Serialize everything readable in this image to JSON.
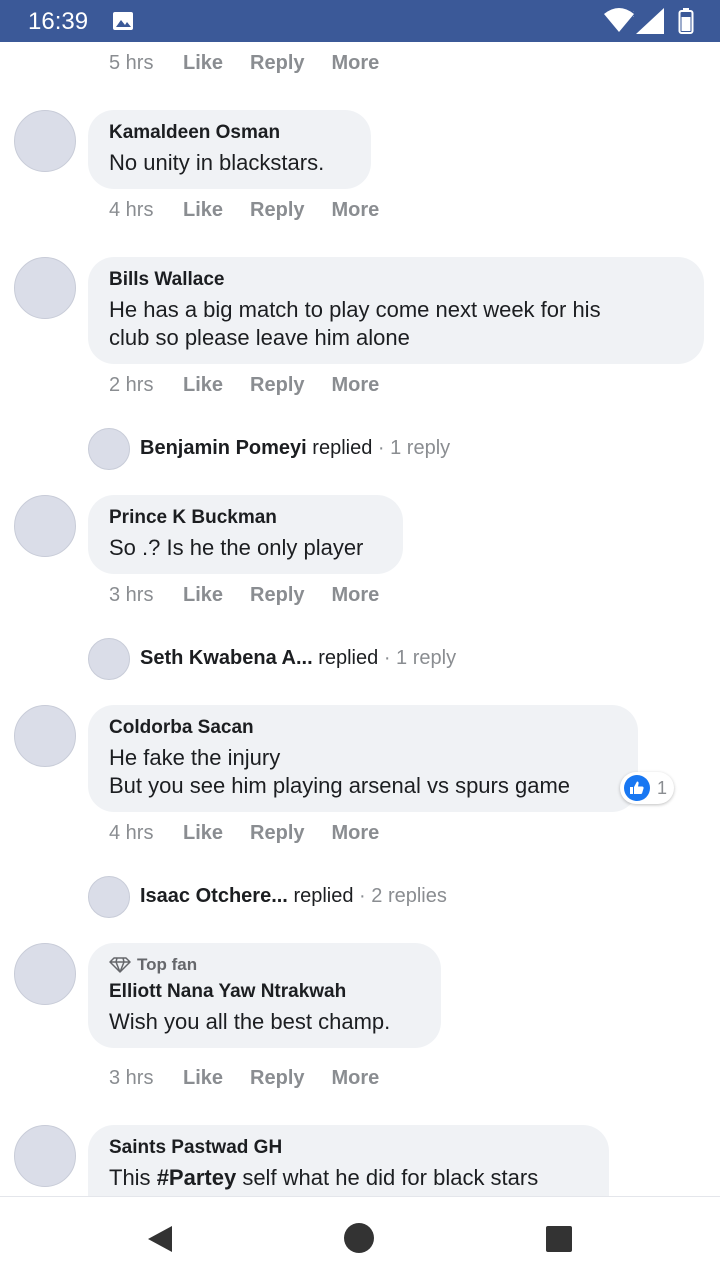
{
  "status_bar": {
    "time": "16:39",
    "icons": [
      "image-icon",
      "wifi-icon",
      "signal-icon",
      "battery-icon"
    ]
  },
  "top_actions": {
    "time": "5 hrs",
    "like": "Like",
    "reply": "Reply",
    "more": "More"
  },
  "comments": [
    {
      "name": "Kamaldeen Osman",
      "text": "No unity in blackstars.",
      "time": "4 hrs",
      "like": "Like",
      "reply": "Reply",
      "more": "More"
    },
    {
      "name": "Bills Wallace",
      "text_lines": [
        "He has a big match to play come next week for his",
        "club so please leave him alone"
      ],
      "time": "2 hrs",
      "like": "Like",
      "reply": "Reply",
      "more": "More",
      "replies": {
        "name": "Benjamin Pomeyi",
        "replied": "replied",
        "separator": "·",
        "count": "1 reply"
      }
    },
    {
      "name": "Prince K Buckman",
      "text": "So .? Is he the only player",
      "time": "3 hrs",
      "like": "Like",
      "reply": "Reply",
      "more": "More",
      "replies": {
        "name": "Seth Kwabena A...",
        "replied": "replied",
        "separator": "·",
        "count": "1 reply"
      }
    },
    {
      "name": "Coldorba Sacan",
      "text_lines": [
        "He fake the injury",
        "But you see him playing arsenal vs spurs game"
      ],
      "time": "4 hrs",
      "like": "Like",
      "reply": "Reply",
      "more": "More",
      "reaction": {
        "icon": "thumbs-up-icon",
        "count": "1"
      },
      "replies": {
        "name": "Isaac Otchere...",
        "replied": "replied",
        "separator": "·",
        "count": "2 replies"
      }
    },
    {
      "badge": "Top fan",
      "name": "Elliott Nana Yaw Ntrakwah",
      "text": "Wish you all the best champ.",
      "time": "3 hrs",
      "like": "Like",
      "reply": "Reply",
      "more": "More"
    },
    {
      "name": "Saints Pastwad GH",
      "text_before": "This ",
      "hashtag": "#Partey",
      "text_after": " self what he did for black stars"
    }
  ],
  "nav_bar": {
    "icons": [
      "back-icon",
      "home-icon",
      "recent-apps-icon"
    ]
  },
  "colors": {
    "status_bar": "#3b5998",
    "bubble": "#f0f2f5",
    "like_blue": "#1877f2",
    "meta_grey": "#8a8d91"
  }
}
